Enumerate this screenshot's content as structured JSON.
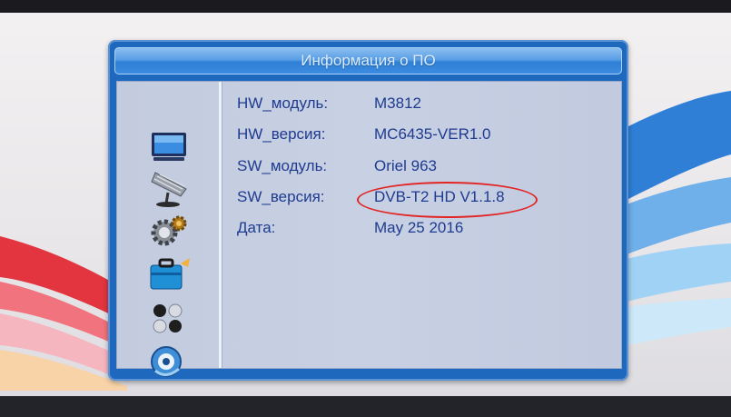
{
  "window": {
    "title": "Информация о ПО"
  },
  "sidebar": {
    "items": [
      {
        "icon": "tv-icon"
      },
      {
        "icon": "satellite-dish-icon"
      },
      {
        "icon": "gear-icon"
      },
      {
        "icon": "toolbox-icon"
      },
      {
        "icon": "dots-icon"
      },
      {
        "icon": "disc-icon"
      }
    ]
  },
  "info": {
    "rows": [
      {
        "label": "HW_модуль:",
        "value": "M3812"
      },
      {
        "label": "HW_версия:",
        "value": "MC6435-VER1.0"
      },
      {
        "label": "SW_модуль:",
        "value": "Oriel 963"
      },
      {
        "label": "SW_версия:",
        "value": "DVB-T2 HD V1.1.8"
      },
      {
        "label": "Дата:",
        "value": "May 25 2016"
      }
    ]
  },
  "colors": {
    "frame": "#1e68bd",
    "panel": "#c6cee2",
    "text": "#1e3b8f",
    "highlight_circle": "#e22525"
  }
}
